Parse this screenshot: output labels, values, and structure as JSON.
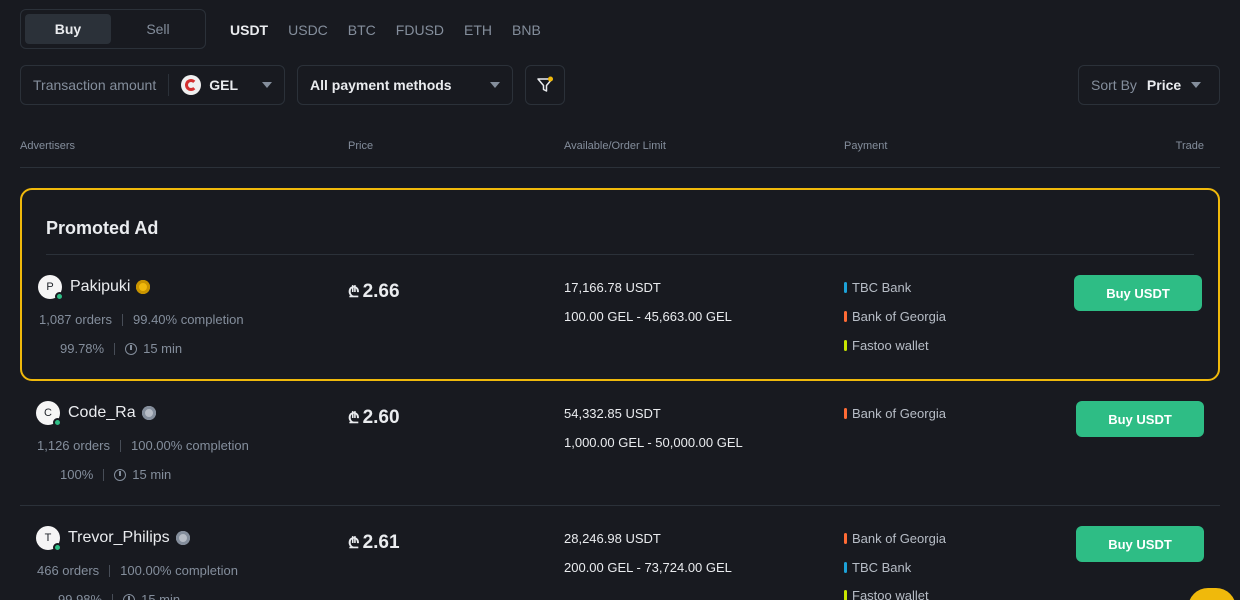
{
  "tabs": {
    "buy": "Buy",
    "sell": "Sell"
  },
  "coins": [
    "USDT",
    "USDC",
    "BTC",
    "FDUSD",
    "ETH",
    "BNB"
  ],
  "filters": {
    "amount_placeholder": "Transaction amount",
    "currency": "GEL",
    "payment": "All payment methods",
    "sort_label": "Sort By",
    "sort_value": "Price"
  },
  "headers": {
    "advertisers": "Advertisers",
    "price": "Price",
    "available": "Available/Order Limit",
    "payment": "Payment",
    "trade": "Trade"
  },
  "promo_title": "Promoted Ad",
  "currency_symbol": "₾",
  "ads": [
    {
      "initial": "P",
      "name": "Pakipuki",
      "badge": "gold",
      "orders": "1,087 orders",
      "completion": "99.40% completion",
      "rate": "99.78%",
      "time": "15 min",
      "price": "2.66",
      "available": "17,166.78 USDT",
      "limit": "100.00 GEL - 45,663.00 GEL",
      "payments": [
        {
          "name": "TBC Bank",
          "color": "#1da2d8"
        },
        {
          "name": "Bank of Georgia",
          "color": "#ff6b35"
        },
        {
          "name": "Fastoo wallet",
          "color": "#c8e600"
        }
      ],
      "button": "Buy USDT"
    },
    {
      "initial": "C",
      "name": "Code_Ra",
      "badge": "silver",
      "orders": "1,126 orders",
      "completion": "100.00% completion",
      "rate": "100%",
      "time": "15 min",
      "price": "2.60",
      "available": "54,332.85 USDT",
      "limit": "1,000.00 GEL - 50,000.00 GEL",
      "payments": [
        {
          "name": "Bank of Georgia",
          "color": "#ff6b35"
        }
      ],
      "button": "Buy USDT"
    },
    {
      "initial": "T",
      "name": "Trevor_Philips",
      "badge": "silver",
      "orders": "466 orders",
      "completion": "100.00% completion",
      "rate": "99.98%",
      "time": "15 min",
      "price": "2.61",
      "available": "28,246.98 USDT",
      "limit": "200.00 GEL - 73,724.00 GEL",
      "payments": [
        {
          "name": "Bank of Georgia",
          "color": "#ff6b35"
        },
        {
          "name": "TBC Bank",
          "color": "#1da2d8"
        },
        {
          "name": "Fastoo wallet",
          "color": "#c8e600"
        }
      ],
      "button": "Buy USDT"
    }
  ]
}
